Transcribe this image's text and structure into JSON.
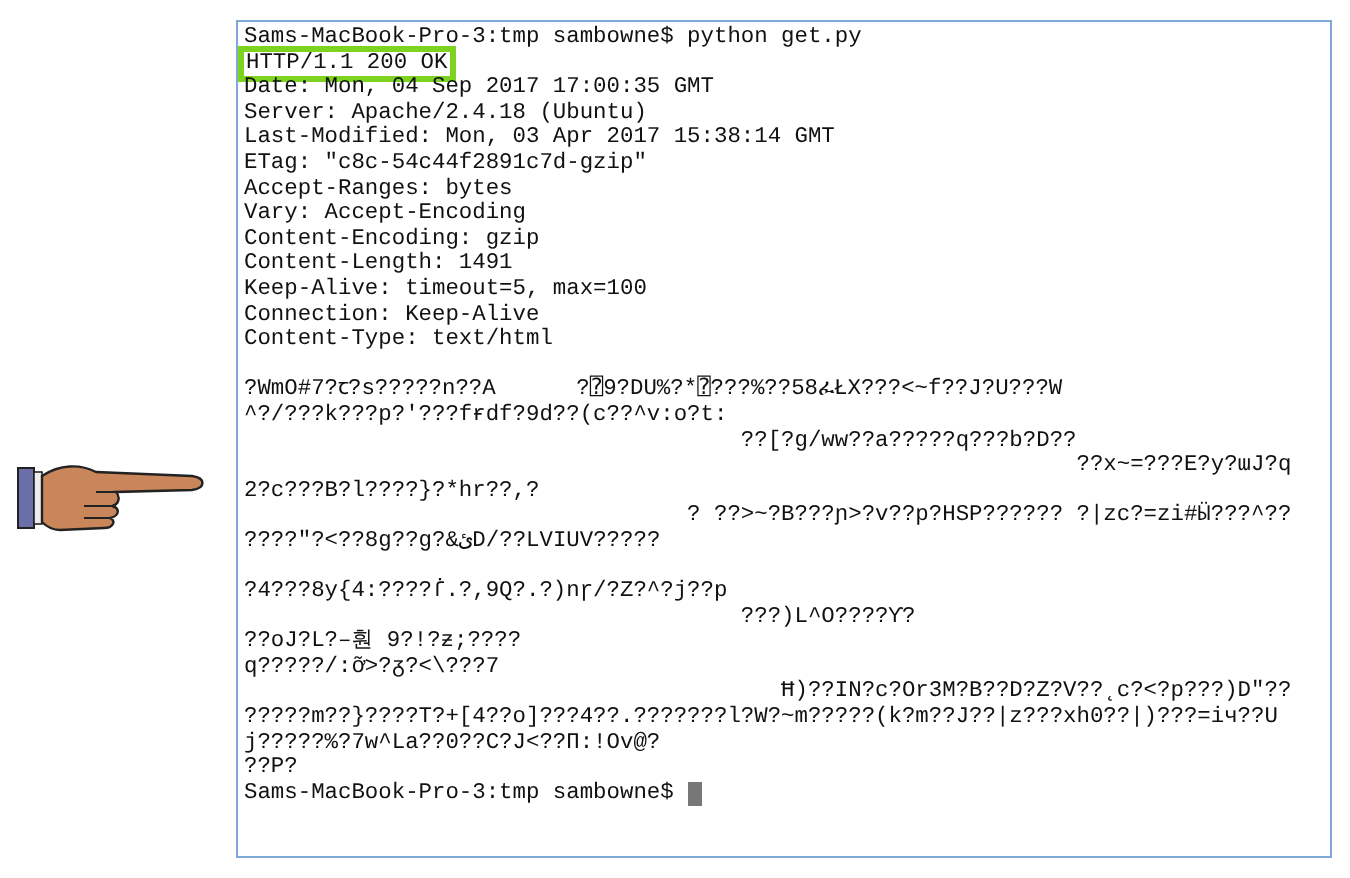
{
  "terminal": {
    "lines": [
      {
        "kind": "text",
        "text": "Sams-MacBook-Pro-3:tmp sambowne$ python get.py",
        "highlighted": false
      },
      {
        "kind": "text",
        "text": "HTTP/1.1 200 OK",
        "highlighted": true
      },
      {
        "kind": "text",
        "text": "Date: Mon, 04 Sep 2017 17:00:35 GMT",
        "highlighted": false
      },
      {
        "kind": "text",
        "text": "Server: Apache/2.4.18 (Ubuntu)",
        "highlighted": false
      },
      {
        "kind": "text",
        "text": "Last-Modified: Mon, 03 Apr 2017 15:38:14 GMT",
        "highlighted": false
      },
      {
        "kind": "text",
        "text": "ETag: \"c8c-54c44f2891c7d-gzip\"",
        "highlighted": false
      },
      {
        "kind": "text",
        "text": "Accept-Ranges: bytes",
        "highlighted": false
      },
      {
        "kind": "text",
        "text": "Vary: Accept-Encoding",
        "highlighted": false
      },
      {
        "kind": "text",
        "text": "Content-Encoding: gzip",
        "highlighted": false
      },
      {
        "kind": "text",
        "text": "Content-Length: 1491",
        "highlighted": false
      },
      {
        "kind": "text",
        "text": "Keep-Alive: timeout=5, max=100",
        "highlighted": false
      },
      {
        "kind": "text",
        "text": "Connection: Keep-Alive",
        "highlighted": false
      },
      {
        "kind": "text",
        "text": "Content-Type: text/html",
        "highlighted": false
      },
      {
        "kind": "blank"
      },
      {
        "kind": "text",
        "text": "?WmO#7?ꞇ?s?????n??A      ?⍰9?DU%?*⍰???%??58ፈŁX???<~f??J?U???W",
        "highlighted": false
      },
      {
        "kind": "text",
        "text": "^?/???k???p?'???fɍdf?9d??(c??^v:o?t:",
        "highlighted": false
      },
      {
        "kind": "text",
        "text": "                                     ??[?g/ww??a?????q???b?D??",
        "highlighted": false
      },
      {
        "kind": "text",
        "text": "                                                              ??x~=???E?y?ɯJ?q",
        "highlighted": false
      },
      {
        "kind": "text",
        "text": "2?c???B?l????}?*hr??,?",
        "highlighted": false
      },
      {
        "kind": "text",
        "text": "                                 ? ??>~?B???ɲ>?v??p?HSP?????? ?|zc?=zi#Ӹ???^??",
        "highlighted": false
      },
      {
        "kind": "text",
        "text": "????\"?<??8g??g?&ئD/??LVIUV?????",
        "highlighted": false
      },
      {
        "kind": "blank"
      },
      {
        "kind": "text",
        "text": "?4???8y{4:????ẛ.?,9Q?.?)nɼ/?Z?^?j??p",
        "highlighted": false
      },
      {
        "kind": "text",
        "text": "                                     ???)L^O????Ƴ?",
        "highlighted": false
      },
      {
        "kind": "text",
        "text": "??oJ?L?–훤 9?!?ƶ;????",
        "highlighted": false
      },
      {
        "kind": "text",
        "text": "q?????/:ỡ>?ᵹ?<\\???7",
        "highlighted": false
      },
      {
        "kind": "text",
        "text": "                                        Ħ)??IN?c?Or3M?B??D?Z?V??˛c?<?p???)D\"??",
        "highlighted": false
      },
      {
        "kind": "text",
        "text": "?????m??}????T?+[4??o]???4??.???????l?W?~m?????(k?m??J??|z???xh0??|)???=iч??U",
        "highlighted": false
      },
      {
        "kind": "text",
        "text": "j?????%?7w^La??0??C?J<??П:!Ov@?",
        "highlighted": false
      },
      {
        "kind": "text",
        "text": "??P?",
        "highlighted": false
      },
      {
        "kind": "prompt",
        "text": "Sams-MacBook-Pro-3:tmp sambowne$",
        "cursor": true
      }
    ]
  }
}
